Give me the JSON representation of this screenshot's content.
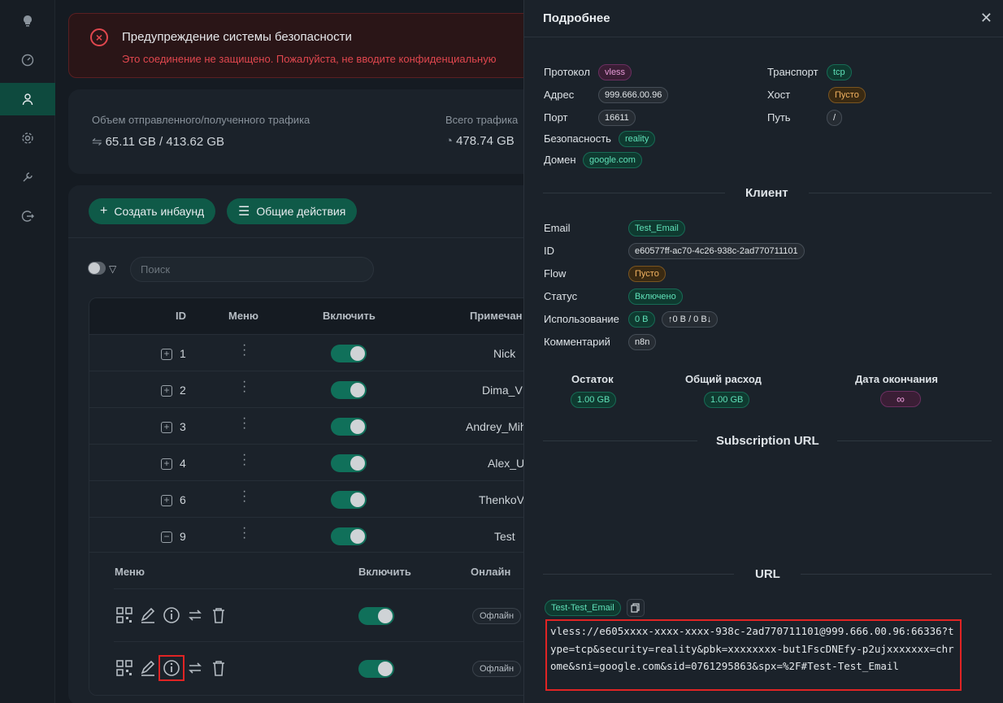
{
  "alert": {
    "title": "Предупреждение системы безопасности",
    "text": "Это соединение не защищено. Пожалуйста, не вводите конфиденциальную"
  },
  "stats": {
    "traffic_label": "Объем отправленного/полученного трафика",
    "traffic_value": "65.11 GB / 413.62 GB",
    "total_label": "Всего трафика",
    "total_value": "478.74 GB"
  },
  "toolbar": {
    "create_label": "Создать инбаунд",
    "actions_label": "Общие действия",
    "search_placeholder": "Поиск"
  },
  "table": {
    "headers": [
      "ID",
      "Меню",
      "Включить",
      "Примечан"
    ],
    "rows": [
      {
        "id": "1",
        "remark": "Nick",
        "expanded": false
      },
      {
        "id": "2",
        "remark": "Dima_VI",
        "expanded": false
      },
      {
        "id": "3",
        "remark": "Andrey_Mih",
        "expanded": false
      },
      {
        "id": "4",
        "remark": "Alex_U",
        "expanded": false
      },
      {
        "id": "6",
        "remark": "ThenkoV",
        "expanded": false
      },
      {
        "id": "9",
        "remark": "Test",
        "expanded": true
      }
    ],
    "sub_headers": [
      "Меню",
      "Включить",
      "Онлайн"
    ],
    "sub_rows": [
      {
        "status": "Офлайн"
      },
      {
        "status": "Офлайн"
      }
    ]
  },
  "drawer": {
    "title": "Подробнее",
    "protocol_label": "Протокол",
    "protocol": "vless",
    "address_label": "Адрес",
    "address": "999.666.00.96",
    "port_label": "Порт",
    "port": "16611",
    "security_label": "Безопасность",
    "security": "reality",
    "domain_label": "Домен",
    "domain": "google.com",
    "transport_label": "Транспорт",
    "transport": "tcp",
    "host_label": "Хост",
    "host": "Пусто",
    "path_label": "Путь",
    "path": "/",
    "client_section": "Клиент",
    "client": {
      "email_label": "Email",
      "email": "Test_Email",
      "id_label": "ID",
      "id": "e60577ff-ac70-4c26-938c-2ad770711101",
      "flow_label": "Flow",
      "flow": "Пусто",
      "status_label": "Статус",
      "status": "Включено",
      "usage_label": "Использование",
      "usage": "0 B",
      "usage_detail": "↑0 B / 0 B↓",
      "comment_label": "Комментарий",
      "comment": "n8n"
    },
    "remaining_label": "Остаток",
    "remaining": "1.00 GB",
    "total_usage_label": "Общий расход",
    "total_usage": "1.00 GB",
    "expiry_label": "Дата окончания",
    "expiry": "∞",
    "subscription_section": "Subscription URL",
    "url_section": "URL",
    "url_tag": "Test-Test_Email",
    "url": "vless://e605xxxx-xxxx-xxxx-938c-2ad770711101@999.666.00.96:66336?type=tcp&security=reality&pbk=xxxxxxxx-but1FscDNEfy-p2ujxxxxxxx=chrome&sni=google.com&sid=0761295863&spx=%2F#Test-Test_Email",
    "close_icon": "close-icon"
  }
}
